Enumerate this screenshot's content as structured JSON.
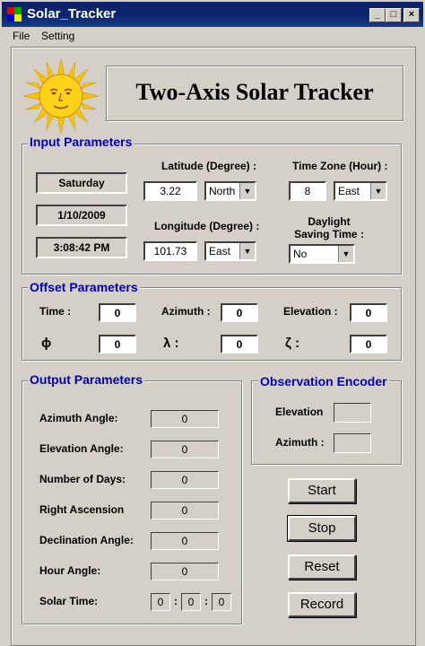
{
  "window": {
    "title": "Solar_Tracker"
  },
  "menu": {
    "file": "File",
    "setting": "Setting"
  },
  "header": {
    "title": "Two-Axis Solar Tracker"
  },
  "input_params": {
    "title": "Input Parameters",
    "day": "Saturday",
    "date": "1/10/2009",
    "time": "3:08:42 PM",
    "latitude_label": "Latitude (Degree) :",
    "latitude_value": "3.22",
    "latitude_dir": "North",
    "longitude_label": "Longitude (Degree) :",
    "longitude_value": "101.73",
    "longitude_dir": "East",
    "timezone_label": "Time Zone (Hour) :",
    "timezone_value": "8",
    "timezone_dir": "East",
    "dst_label_1": "Daylight",
    "dst_label_2": "Saving Time :",
    "dst_value": "No"
  },
  "offset_params": {
    "title": "Offset Parameters",
    "time_label": "Time :",
    "time_value": "0",
    "azimuth_label": "Azimuth :",
    "azimuth_value": "0",
    "elevation_label": "Elevation :",
    "elevation_value": "0",
    "phi_label": "ϕ",
    "phi_value": "0",
    "lambda_label": "λ :",
    "lambda_value": "0",
    "zeta_label": "ζ :",
    "zeta_value": "0"
  },
  "output_params": {
    "title": "Output Parameters",
    "rows": [
      {
        "label": "Azimuth Angle:",
        "value": "0"
      },
      {
        "label": "Elevation Angle:",
        "value": "0"
      },
      {
        "label": "Number of Days:",
        "value": "0"
      },
      {
        "label": "Right Ascension",
        "value": "0"
      },
      {
        "label": "Declination Angle:",
        "value": "0"
      },
      {
        "label": "Hour Angle:",
        "value": "0"
      }
    ],
    "solar_time_label": "Solar Time:",
    "solar_time_h": "0",
    "solar_time_m": "0",
    "solar_time_s": "0",
    "sep": ":"
  },
  "encoder": {
    "title": "Observation Encoder",
    "elevation_label": "Elevation",
    "azimuth_label": "Azimuth :"
  },
  "buttons": {
    "start": "Start",
    "stop": "Stop",
    "reset": "Reset",
    "record": "Record"
  }
}
